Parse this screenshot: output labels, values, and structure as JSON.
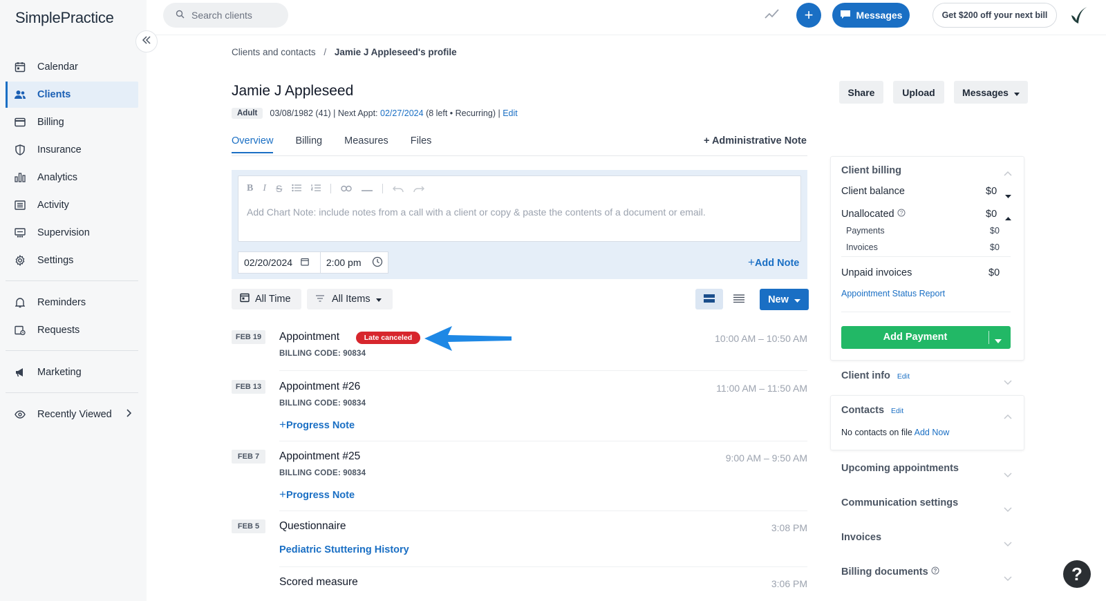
{
  "app": {
    "logo": "SimplePractice"
  },
  "sidebar": {
    "items": [
      {
        "label": "Calendar",
        "icon": "calendar-icon"
      },
      {
        "label": "Clients",
        "icon": "clients-icon",
        "active": true
      },
      {
        "label": "Billing",
        "icon": "billing-icon"
      },
      {
        "label": "Insurance",
        "icon": "shield-icon"
      },
      {
        "label": "Analytics",
        "icon": "analytics-icon"
      },
      {
        "label": "Activity",
        "icon": "activity-icon"
      },
      {
        "label": "Supervision",
        "icon": "supervision-icon"
      },
      {
        "label": "Settings",
        "icon": "gear-icon"
      }
    ],
    "secondary": [
      {
        "label": "Reminders",
        "icon": "bell-icon"
      },
      {
        "label": "Requests",
        "icon": "requests-icon"
      }
    ],
    "marketing": {
      "label": "Marketing",
      "icon": "megaphone-icon"
    },
    "recently_viewed": {
      "label": "Recently Viewed",
      "icon": "eye-icon"
    }
  },
  "topbar": {
    "search_placeholder": "Search clients",
    "messages_label": "Messages",
    "promo_label": "Get $200 off your next bill"
  },
  "breadcrumb": {
    "parent": "Clients and contacts",
    "separator": "/",
    "current": "Jamie J Appleseed's profile"
  },
  "client": {
    "name": "Jamie J Appleseed",
    "badge": "Adult",
    "dob": "03/08/1982 (41) | Next Appt:",
    "next_appt": "02/27/2024",
    "appt_detail": "(8 left • Recurring) |",
    "edit": "Edit"
  },
  "header_buttons": {
    "share": "Share",
    "upload": "Upload",
    "messages": "Messages"
  },
  "tabs": [
    {
      "label": "Overview",
      "active": true
    },
    {
      "label": "Billing"
    },
    {
      "label": "Measures"
    },
    {
      "label": "Files"
    }
  ],
  "admin_note": "+ Administrative Note",
  "note_editor": {
    "placeholder": "Add Chart Note: include notes from a call with a client or copy & paste the contents of a document or email.",
    "date": "02/20/2024",
    "time": "2:00 pm",
    "add_note": "Add Note"
  },
  "filters": {
    "time": "All Time",
    "items": "All Items",
    "new": "New"
  },
  "timeline": [
    {
      "date": "FEB 19",
      "title": "Appointment",
      "badge": "Late canceled",
      "time": "10:00 AM – 10:50 AM",
      "code": "BILLING CODE: 90834"
    },
    {
      "date": "FEB 13",
      "title": "Appointment #26",
      "time": "11:00 AM – 11:50 AM",
      "code": "BILLING CODE: 90834",
      "link": "Progress Note"
    },
    {
      "date": "FEB 7",
      "title": "Appointment #25",
      "time": "9:00 AM – 9:50 AM",
      "code": "BILLING CODE: 90834",
      "link": "Progress Note"
    },
    {
      "date": "FEB 5",
      "title": "Questionnaire",
      "time": "3:08 PM",
      "link": "Pediatric Stuttering History"
    },
    {
      "title": "Scored measure",
      "time": "3:06 PM"
    }
  ],
  "billing_panel": {
    "title": "Client billing",
    "balance_label": "Client balance",
    "balance": "$0",
    "unallocated_label": "Unallocated",
    "unallocated": "$0",
    "payments_label": "Payments",
    "payments": "$0",
    "invoices_label": "Invoices",
    "invoices": "$0",
    "unpaid_label": "Unpaid invoices",
    "unpaid": "$0",
    "report_link": "Appointment Status Report",
    "add_payment": "Add Payment"
  },
  "client_info": {
    "title": "Client info",
    "edit": "Edit"
  },
  "contacts": {
    "title": "Contacts",
    "edit": "Edit",
    "empty": "No contacts on file",
    "add": "Add Now"
  },
  "sections": [
    "Upcoming appointments",
    "Communication settings",
    "Invoices",
    "Billing documents"
  ],
  "colors": {
    "accent": "#1a6fc4",
    "success": "#22b866",
    "danger": "#d7262d"
  }
}
